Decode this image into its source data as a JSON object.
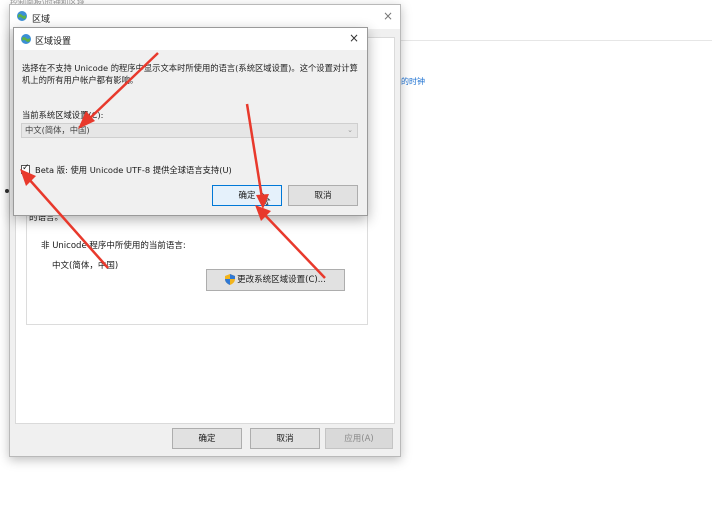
{
  "background": {
    "title": "控制面板\\时钟和区域",
    "link_fragment": "的时钟"
  },
  "window": {
    "title": "区域",
    "icon": "globe-region-icon",
    "close_glyph": "×",
    "panel": {
      "lang_tail": "的语言。",
      "non_unicode_label": "非 Unicode 程序中所使用的当前语言:",
      "non_unicode_value": "中文(简体，中国)",
      "change_button": "更改系统区域设置(C)..."
    },
    "buttons": {
      "ok": "确定",
      "cancel": "取消",
      "apply": "应用(A)"
    }
  },
  "dialog": {
    "title": "区域设置",
    "icon": "globe-region-icon",
    "close_glyph": "×",
    "description": "选择在不支持 Unicode 的程序中显示文本时所使用的语言(系统区域设置)。这个设置对计算机上的所有用户帐户都有影响。",
    "current_locale_label": "当前系统区域设置(C):",
    "current_locale_value": "中文(简体，中国)",
    "beta_checkbox_label": "Beta 版: 使用 Unicode UTF-8 提供全球语言支持(U)",
    "beta_checked": true,
    "ok": "确定",
    "cancel": "取消"
  },
  "colors": {
    "annotation_arrow": "#e8392c",
    "accent": "#0078d7",
    "link": "#1a6fd1"
  }
}
